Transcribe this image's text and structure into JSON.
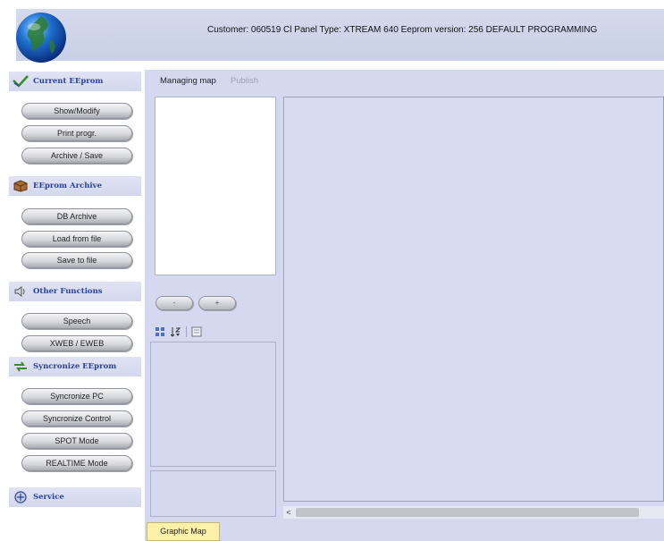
{
  "header": {
    "info": "Customer: 060519 Cl Panel Type: XTREAM 640 Eeprom version: 256  DEFAULT PROGRAMMING"
  },
  "sidebar": {
    "sections": [
      {
        "title": "Current EEprom",
        "icon": "checkmark-icon",
        "buttons": [
          "Show/Modify",
          "Print progr.",
          "Archive / Save"
        ]
      },
      {
        "title": "EEprom Archive",
        "icon": "box-icon",
        "buttons": [
          "DB Archive",
          "Load from file",
          "Save to file"
        ]
      },
      {
        "title": "Other Functions",
        "icon": "speaker-icon",
        "buttons": [
          "Speech",
          "XWEB / EWEB"
        ]
      },
      {
        "title": "Syncronize EEprom",
        "icon": "sync-icon",
        "buttons": [
          "Syncronize PC",
          "Syncronize Control",
          "SPOT Mode",
          "REALTIME Mode"
        ]
      },
      {
        "title": "Service",
        "icon": "service-icon",
        "buttons": []
      }
    ]
  },
  "main": {
    "tabs": [
      "Managing map",
      "Publish"
    ],
    "round_buttons": [
      "-",
      "+"
    ],
    "scroll_left": "<",
    "bottom_tab": "Graphic Map"
  }
}
